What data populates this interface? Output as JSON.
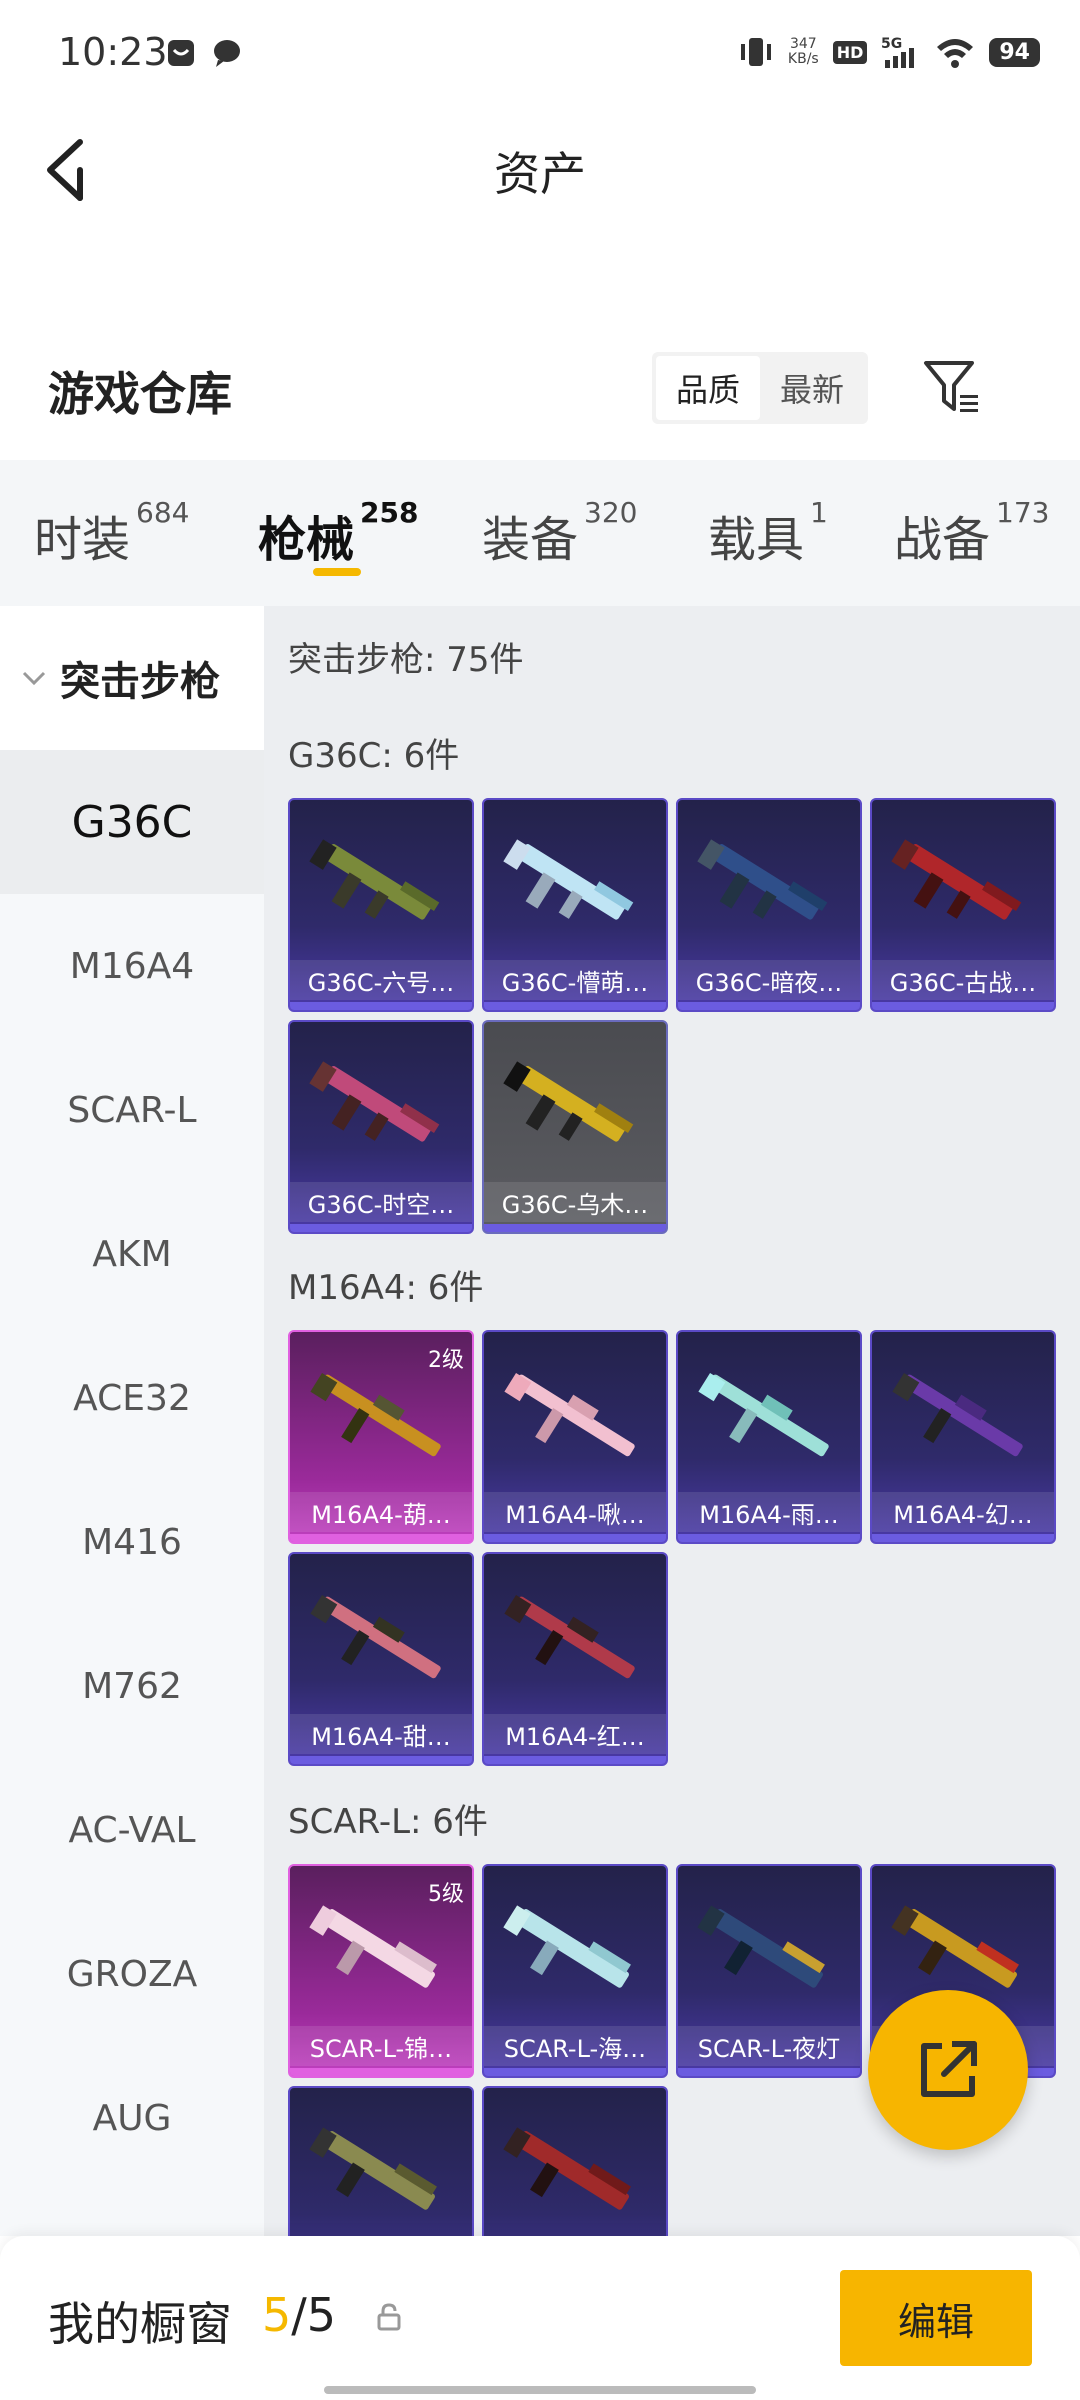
{
  "status": {
    "time": "10:23",
    "net_speed_value": "347",
    "net_speed_unit": "KB/s",
    "hd": "HD",
    "signal": "5G",
    "battery": "94"
  },
  "header": {
    "title": "资产"
  },
  "warehouse": {
    "title": "游戏仓库",
    "sort_options": [
      "品质",
      "最新"
    ],
    "sort_selected": "品质"
  },
  "tabs": [
    {
      "label": "时装",
      "count": "684"
    },
    {
      "label": "枪械",
      "count": "258",
      "active": true
    },
    {
      "label": "装备",
      "count": "320"
    },
    {
      "label": "载具",
      "count": "1"
    },
    {
      "label": "战备",
      "count": "173"
    }
  ],
  "sidebar": {
    "category": "突击步枪",
    "items": [
      "G36C",
      "M16A4",
      "SCAR-L",
      "AKM",
      "ACE32",
      "M416",
      "M762",
      "AC-VAL",
      "GROZA",
      "AUG"
    ],
    "active": "G36C"
  },
  "content": {
    "summary": "突击步枪: 75件",
    "sections": [
      {
        "title": "G36C: 6件",
        "items": [
          {
            "name": "G36C-六号…"
          },
          {
            "name": "G36C-懵萌…"
          },
          {
            "name": "G36C-暗夜…"
          },
          {
            "name": "G36C-古战…"
          },
          {
            "name": "G36C-时空…"
          },
          {
            "name": "G36C-乌木…"
          }
        ]
      },
      {
        "title": "M16A4: 6件",
        "items": [
          {
            "name": "M16A4-葫…",
            "level": "2级"
          },
          {
            "name": "M16A4-啾…"
          },
          {
            "name": "M16A4-雨…"
          },
          {
            "name": "M16A4-幻…"
          },
          {
            "name": "M16A4-甜…"
          },
          {
            "name": "M16A4-红…"
          }
        ]
      },
      {
        "title": "SCAR-L: 6件",
        "items": [
          {
            "name": "SCAR-L-锦…",
            "level": "5级"
          },
          {
            "name": "SCAR-L-海…"
          },
          {
            "name": "SCAR-L-夜灯"
          },
          {
            "name": "…"
          }
        ]
      }
    ]
  },
  "showcase": {
    "label": "我的橱窗",
    "current": "5",
    "total": "/5",
    "edit_label": "编辑"
  }
}
